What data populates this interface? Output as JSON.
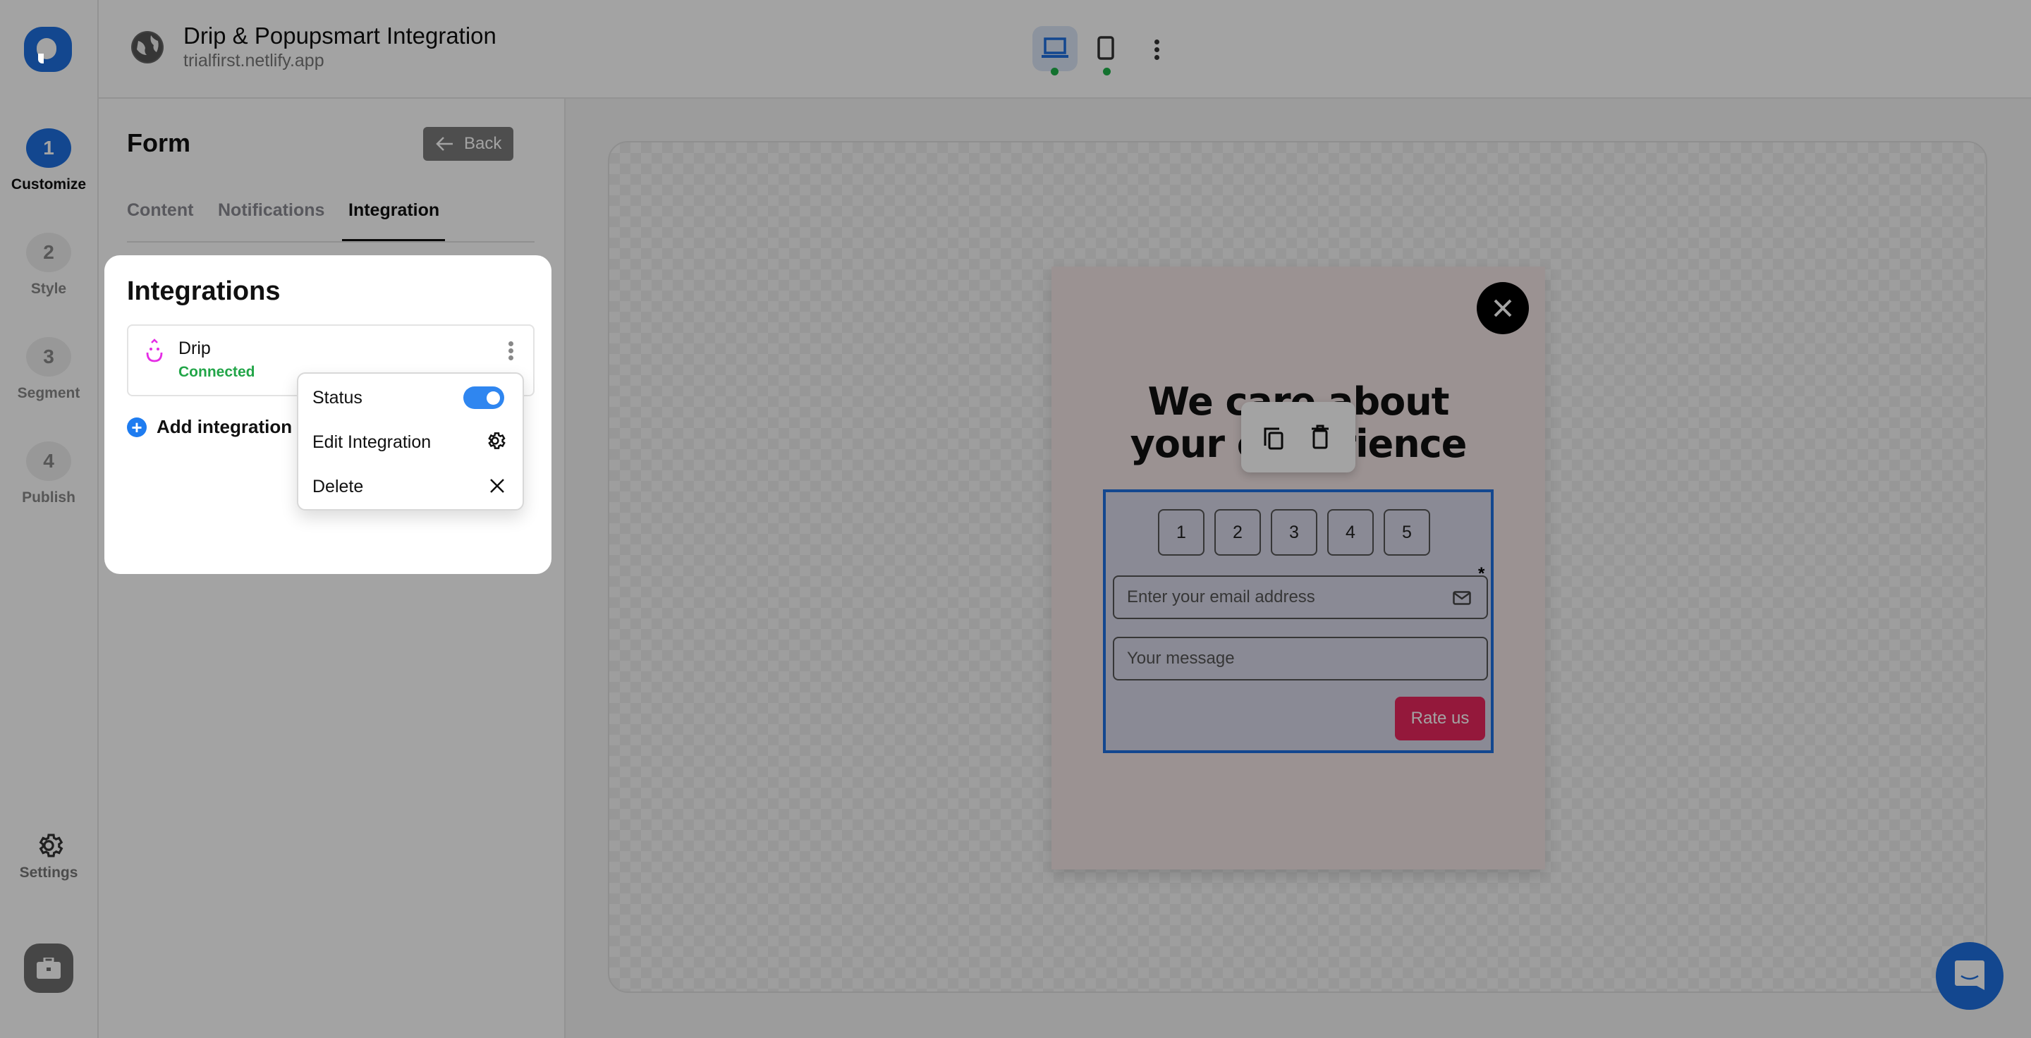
{
  "header": {
    "title": "Drip & Popupsmart Integration",
    "subtitle": "trialfirst.netlify.app",
    "device_toggle": {
      "desktop_label": "desktop-preview",
      "mobile_label": "mobile-preview",
      "active": "desktop"
    },
    "status_dot_color": "#1fb24a"
  },
  "sidebar": {
    "steps": [
      {
        "number": "1",
        "label": "Customize",
        "active": true
      },
      {
        "number": "2",
        "label": "Style",
        "active": false
      },
      {
        "number": "3",
        "label": "Segment",
        "active": false
      },
      {
        "number": "4",
        "label": "Publish",
        "active": false
      }
    ],
    "settings_label": "Settings"
  },
  "panel": {
    "title": "Form",
    "back_label": "Back",
    "tabs": [
      {
        "label": "Content",
        "active": false
      },
      {
        "label": "Notifications",
        "active": false
      },
      {
        "label": "Integration",
        "active": true
      }
    ]
  },
  "integrations": {
    "title": "Integrations",
    "items": [
      {
        "name": "Drip",
        "status": "Connected",
        "status_color": "#22a548",
        "brand_color": "#e52ce5"
      }
    ],
    "add_label": "Add integration"
  },
  "context_menu": {
    "items": [
      {
        "label": "Status",
        "control": "toggle",
        "enabled": true
      },
      {
        "label": "Edit Integration",
        "icon": "gear-icon"
      },
      {
        "label": "Delete",
        "icon": "close-icon"
      }
    ]
  },
  "preview": {
    "headline_line1": "We care about",
    "headline_line2": "your experience",
    "rating_options": [
      "1",
      "2",
      "3",
      "4",
      "5"
    ],
    "email_placeholder": "Enter your email address",
    "message_placeholder": "Your message",
    "required_marker": "*",
    "submit_label": "Rate us",
    "submit_color": "#e8265d",
    "selection_color": "#1e6fe0"
  },
  "colors": {
    "accent": "#1e6fe0",
    "toggle_on": "#2f86f0"
  }
}
